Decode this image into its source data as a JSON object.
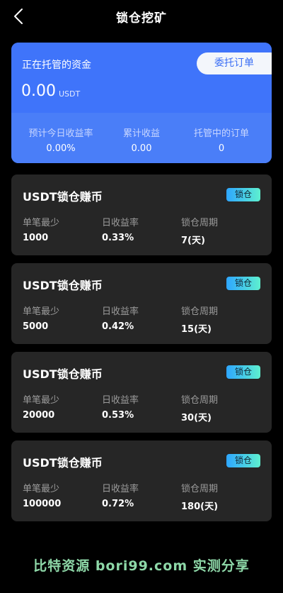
{
  "header": {
    "title": "锁仓挖矿"
  },
  "summary": {
    "label": "正在托管的资金",
    "amount": "0.00",
    "unit": "USDT",
    "entrust_button": "委托订单",
    "stats": [
      {
        "label": "预计今日收益率",
        "value": "0.00%"
      },
      {
        "label": "累计收益",
        "value": "0.00"
      },
      {
        "label": "托管中的订单",
        "value": "0"
      }
    ]
  },
  "products": [
    {
      "title": "USDT锁仓赚币",
      "tag": "锁仓",
      "min_label": "单笔最少",
      "min_value": "1000",
      "rate_label": "日收益率",
      "rate_value": "0.33%",
      "period_label": "锁仓周期",
      "period_value": "7(天)"
    },
    {
      "title": "USDT锁仓赚币",
      "tag": "锁仓",
      "min_label": "单笔最少",
      "min_value": "5000",
      "rate_label": "日收益率",
      "rate_value": "0.42%",
      "period_label": "锁仓周期",
      "period_value": "15(天)"
    },
    {
      "title": "USDT锁仓赚币",
      "tag": "锁仓",
      "min_label": "单笔最少",
      "min_value": "20000",
      "rate_label": "日收益率",
      "rate_value": "0.53%",
      "period_label": "锁仓周期",
      "period_value": "30(天)"
    },
    {
      "title": "USDT锁仓赚币",
      "tag": "锁仓",
      "min_label": "单笔最少",
      "min_value": "100000",
      "rate_label": "日收益率",
      "rate_value": "0.72%",
      "period_label": "锁仓周期",
      "period_value": "180(天)"
    }
  ],
  "watermark": {
    "text": "比特资源 bori99.com 实测分享"
  },
  "icons": {
    "back": "chevron-left-icon"
  },
  "colors": {
    "background": "#000000",
    "primary_blue": "#3f74fa",
    "card_bg": "#262626",
    "tag_gradient_start": "#2ea6ff",
    "tag_gradient_end": "#5ef0cf",
    "watermark": "#8ed8a8"
  }
}
